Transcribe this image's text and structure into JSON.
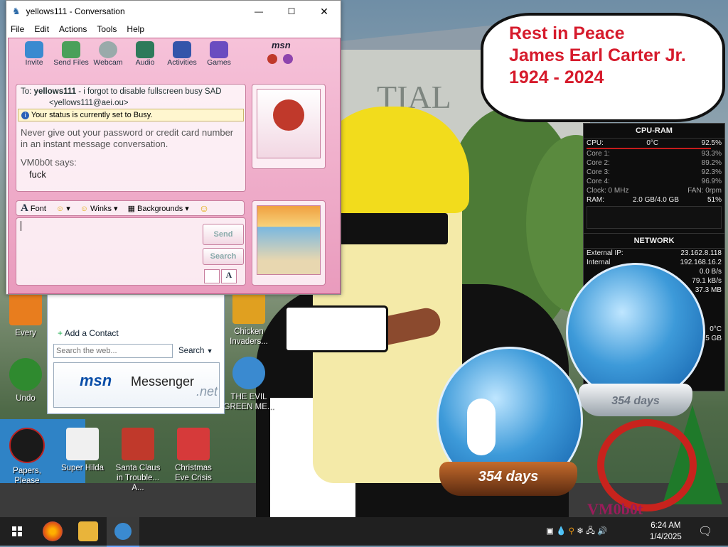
{
  "window": {
    "title": "yellows111 - Conversation",
    "menus": [
      "File",
      "Edit",
      "Actions",
      "Tools",
      "Help"
    ],
    "brand": "msn",
    "toolbar": [
      "Invite",
      "Send Files",
      "Webcam",
      "Audio",
      "Activities",
      "Games"
    ]
  },
  "conversation": {
    "to_label": "To:",
    "to_name": "yellows111",
    "to_message": "- i forgot to disable fullscreen busy SAD",
    "to_email": "<yellows111@aei.ou>",
    "status_notice": "Your status is currently set to Busy.",
    "warning": "Never give out your password or credit card number in an instant message conversation.",
    "sender": "VM0b0t says:",
    "message": "fuck"
  },
  "compose": {
    "font": "Font",
    "winks": "Winks",
    "backgrounds": "Backgrounds",
    "send": "Send",
    "search": "Search"
  },
  "messenger": {
    "add_contact": "Add a Contact",
    "search_placeholder": "Search the web...",
    "search_button": "Search",
    "banner_msn": "msn",
    "banner_messenger": "Messenger",
    "banner_net": ".net"
  },
  "wallpaper": {
    "bubble_line1": "Rest in Peace",
    "bubble_line2": "James Earl Carter Jr.",
    "bubble_line3": "1924 - 2024",
    "building_text": "TIAL",
    "signature": "VM0b0t"
  },
  "gadget": {
    "cpu_title": "CPU-RAM",
    "cpu_label": "CPU:",
    "cpu_temp": "0°C",
    "cpu_value": "92.5%",
    "cores": [
      {
        "label": "Core 1:",
        "value": "93.3%"
      },
      {
        "label": "Core 2:",
        "value": "89.2%"
      },
      {
        "label": "Core 3:",
        "value": "92.3%"
      },
      {
        "label": "Core 4:",
        "value": "96.9%"
      }
    ],
    "clock": "Clock: 0 MHz",
    "fan": "FAN: 0rpm",
    "ram_label": "RAM:",
    "ram_value": "2.0 GB/4.0 GB",
    "ram_pct": "51%",
    "net_title": "NETWORK",
    "ext_ip_label": "External IP:",
    "ext_ip": "23.162.8.118",
    "int_ip_label": "Internal",
    "int_ip": "192.168.16.2",
    "rate1": "0.0 B/s",
    "rate2": "79.1 kB/s",
    "total": "37.3 MB",
    "temp2": "0°C",
    "disk": "9.5 GB"
  },
  "globes": {
    "front_days": "354 days",
    "back_days": "354 days"
  },
  "desktop_icons": [
    {
      "label": "Every"
    },
    {
      "label": "Undo"
    },
    {
      "label": "Chicken Invaders..."
    },
    {
      "label": "THE EVIL GREEN ME..."
    },
    {
      "label": "Papers, Please"
    },
    {
      "label": "Super Hilda"
    },
    {
      "label": "Santa Claus in Trouble... A..."
    },
    {
      "label": "Christmas Eve Crisis"
    }
  ],
  "taskbar": {
    "time": "6:24 AM",
    "date": "1/4/2025"
  },
  "colors": {
    "pink": "#e99bbd",
    "bubble_text": "#d61b2c",
    "taskbar": "#202020"
  }
}
